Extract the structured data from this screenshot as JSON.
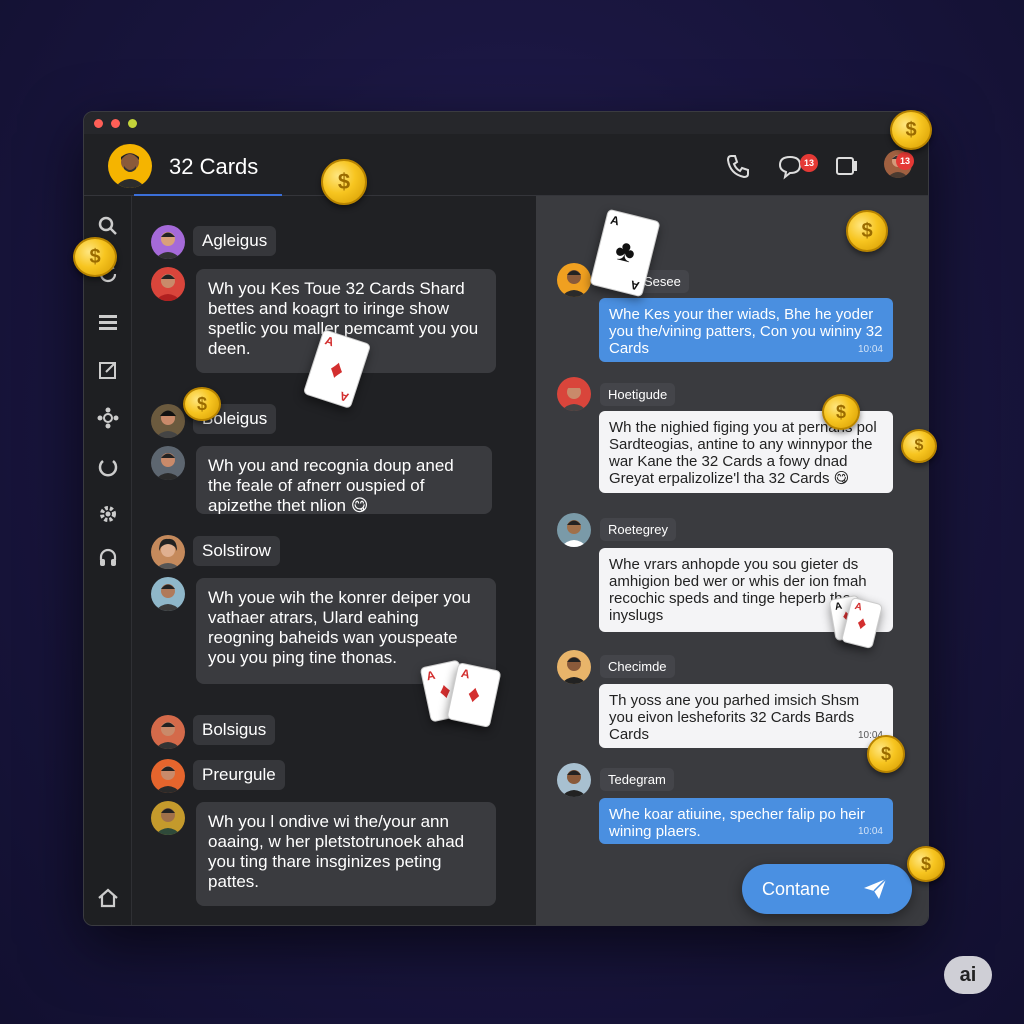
{
  "header": {
    "title": "32 Cards",
    "chat_badge": "13",
    "profile_badge": "13"
  },
  "sidebar": {
    "icons": [
      "search-icon",
      "refresh-icon",
      "list-icon",
      "edit-icon",
      "gear-flower-icon",
      "power-icon",
      "settings-icon",
      "headset-icon",
      "home-icon"
    ]
  },
  "left_chat": [
    {
      "name": "Agleigus",
      "avatar_color": "#a56ad9"
    },
    {
      "avatar_color": "#d9453b",
      "text": "Wh you Kes Toue 32 Cards Shard bettes and koagrt to iringe show spetlic you maller pemcamt you you deen."
    },
    {
      "name": "Boleigus",
      "avatar_color": "#6b5a3e"
    },
    {
      "avatar_color": "#5d6670",
      "text": "Wh you and recognia doup aned the feale of afnerr ouspied of apizethe thet nlion 😋"
    },
    {
      "name": "Solstirow",
      "avatar_color": "#c58a5c"
    },
    {
      "avatar_color": "#8fb7c9",
      "text": "Wh youe wih the konrer deiper you vathaer atrars, Ulard eahing reogning baheids wan youspeate you you ping tine thonas."
    },
    {
      "name": "Bolsigus",
      "avatar_color": "#d46a4a"
    },
    {
      "name": "Preurgule",
      "avatar_color": "#e5652d"
    },
    {
      "avatar_color": "#c49a2c",
      "text": "Wh you l ondive wi the/your ann oaaing, w her pletstotrunoek ahad you ting thare insginizes peting pattes."
    }
  ],
  "right_chat": [
    {
      "name": "Sesee",
      "avatar_color": "#f0a020",
      "style": "blue",
      "text": "Whe Kes your ther wiads, Bhe he yoder you the/vining patters, Con you wininy 32 Cards",
      "time": "10:04"
    },
    {
      "name": "Hoetigude",
      "avatar_color": "#d9453b",
      "style": "white",
      "text": "Wh the nighied figing you at pernaris pol Sardteogias, antine to any winnypor the war Kane the 32 Cards a fowy dnad Greyat erpalizolize'l tha 32 Cards 😋"
    },
    {
      "name": "Roetegrey",
      "avatar_color": "#7a9aa8",
      "style": "white",
      "text": "Whe vrars anhopde you sou gieter ds amhigion bed wer or whis der ion fmah recochic speds and tinge heperb the inyslugs"
    },
    {
      "name": "Checimde",
      "avatar_color": "#e8b46a",
      "style": "white",
      "text": "Th yoss ane you parhed imsich Shsm you eivon lesheforits 32 Cards Bards Cards",
      "time": "10:04"
    },
    {
      "name": "Tedegram",
      "avatar_color": "#a8c0d0",
      "style": "blue",
      "text": "Whe koar atiuine, specher falip po heir wining plaers.",
      "time": "10:04"
    }
  ],
  "compose": {
    "send_label": "Contane"
  },
  "watermark": "ai",
  "colors": {
    "accent": "#4a90e2",
    "badge": "#e53935",
    "coin": "#f7c520"
  }
}
